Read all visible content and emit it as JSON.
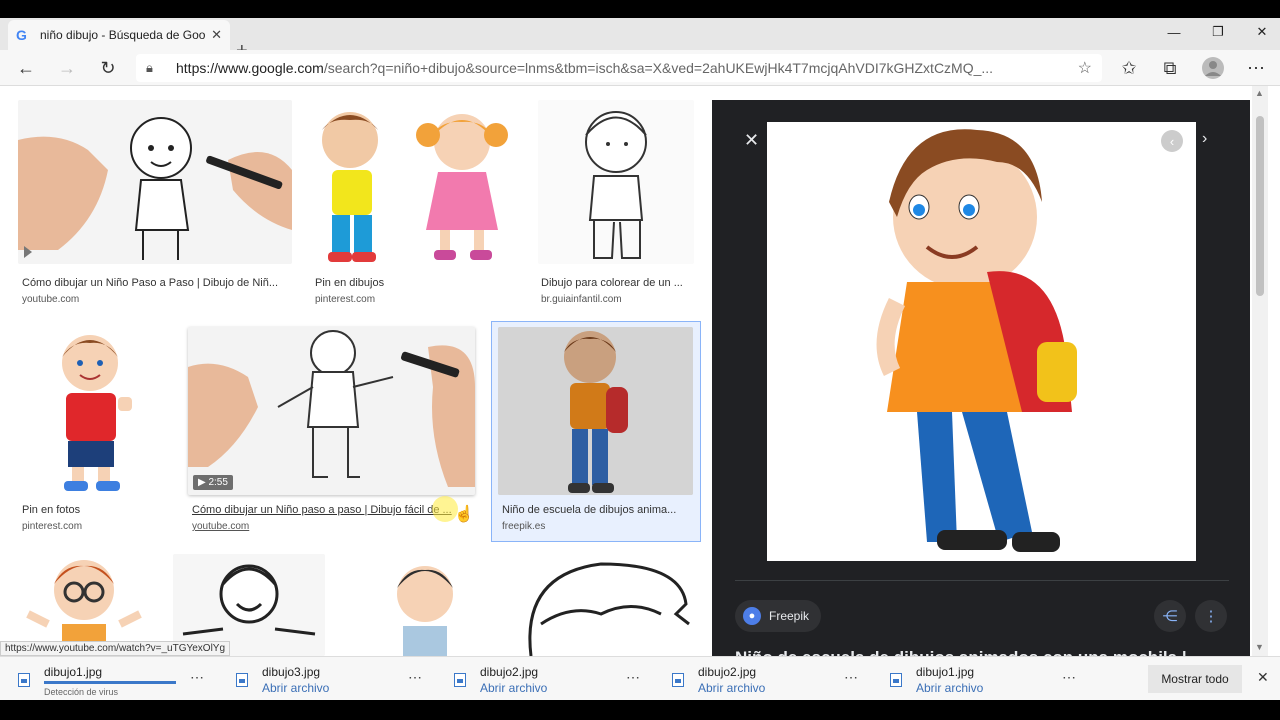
{
  "browser": {
    "tab_icon": "G",
    "tab_title": "niño dibujo - Búsqueda de Goog",
    "tab_close": "✕",
    "new_tab": "+",
    "window_controls": {
      "minimize": "—",
      "maximize": "❐",
      "close": "✕"
    },
    "url_host": "https://www.google.com",
    "url_rest": "/search?q=niño+dibujo&source=lnms&tbm=isch&sa=X&ved=2ahUKEwjHk4T7mcjqAhVDI7kGHZxtCzMQ_..."
  },
  "results": [
    {
      "caption": "Cómo dibujar un Niño Paso a Paso | Dibujo de Niñ...",
      "source": "youtube.com"
    },
    {
      "caption": "Pin en dibujos",
      "source": "pinterest.com"
    },
    {
      "caption": "Dibujo para colorear de un ...",
      "source": "br.guiainfantil.com"
    },
    {
      "caption": "Pin en fotos",
      "source": "pinterest.com"
    },
    {
      "caption": "Cómo dibujar un Niño paso a paso | Dibujo fácil de ...",
      "source": "youtube.com",
      "duration": "▶ 2:55"
    },
    {
      "caption": "Niño de escuela de dibujos anima...",
      "source": "freepik.es"
    }
  ],
  "status_url": "https://www.youtube.com/watch?v=_uTGYexOlYg",
  "preview": {
    "close": "✕",
    "source_chip": "Freepik",
    "title": "Niño de escuela de dibujos animados con una mochila |"
  },
  "downloads": [
    {
      "name": "dibujo1.jpg",
      "status": "Detección de virus",
      "scanning": true
    },
    {
      "name": "dibujo3.jpg",
      "status": "Abrir archivo"
    },
    {
      "name": "dibujo2.jpg",
      "status": "Abrir archivo"
    },
    {
      "name": "dibujo2.jpg",
      "status": "Abrir archivo"
    },
    {
      "name": "dibujo1.jpg",
      "status": "Abrir archivo"
    }
  ],
  "download_bar": {
    "show_all": "Mostrar todo",
    "close": "✕"
  },
  "colors": {
    "panel_bg": "#202124",
    "link_blue": "#3b6fb6",
    "selected_border": "#8ab4f8"
  }
}
